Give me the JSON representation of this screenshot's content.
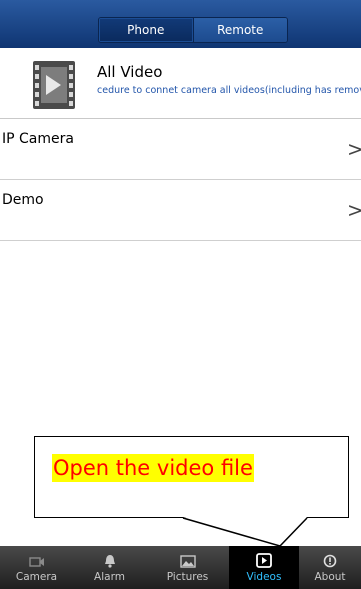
{
  "header": {
    "tabs": [
      {
        "label": "Phone",
        "active": true
      },
      {
        "label": "Remote",
        "active": false
      }
    ]
  },
  "all_video": {
    "title": "All Video",
    "subtitle": "cedure to connet camera all videos(including has remove"
  },
  "list": [
    {
      "label": "IP Camera"
    },
    {
      "label": "Demo"
    }
  ],
  "callout": {
    "text": "Open the video file"
  },
  "bottom_nav": {
    "items": [
      {
        "label": "Camera",
        "icon": "camera-icon"
      },
      {
        "label": "Alarm",
        "icon": "bell-icon"
      },
      {
        "label": "Pictures",
        "icon": "picture-icon"
      },
      {
        "label": "Videos",
        "icon": "video-icon",
        "active": true
      },
      {
        "label": "About",
        "icon": "info-icon"
      }
    ],
    "active_color": "#31c0ff"
  },
  "colors": {
    "header": "#1f4d91",
    "callout_text": "#ff0000",
    "callout_highlight": "#ffff00"
  }
}
